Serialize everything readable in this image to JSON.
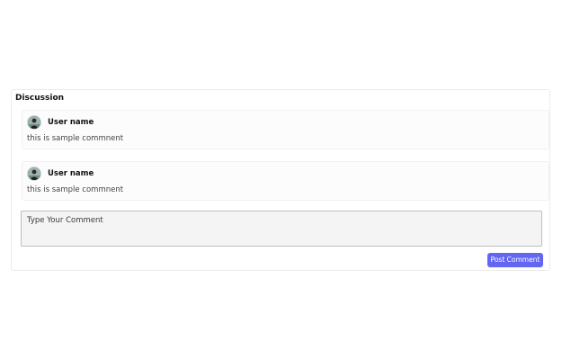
{
  "discussion": {
    "title": "Discussion",
    "comments": [
      {
        "user": "User name",
        "text": "this is sample commnent",
        "avatar_icon": "user-avatar-icon"
      },
      {
        "user": "User name",
        "text": "this is sample commnent",
        "avatar_icon": "user-avatar-icon"
      }
    ],
    "input": {
      "placeholder": "Type Your Comment",
      "value": ""
    },
    "post_button_label": "Post Comment"
  },
  "colors": {
    "accent": "#6366f1",
    "input_background": "#f4f4f5",
    "border": "#ececec"
  }
}
